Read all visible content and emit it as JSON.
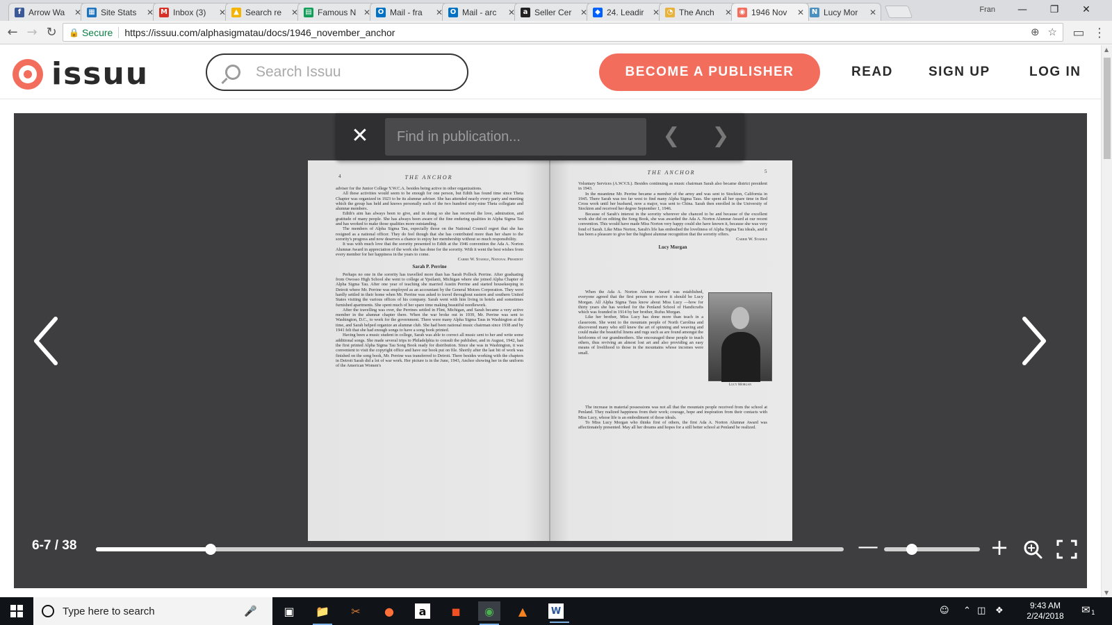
{
  "browser": {
    "tabs": [
      {
        "label": "Arrow Wa",
        "icon": "facebook-icon",
        "color": "#3b5998"
      },
      {
        "label": "Site Stats",
        "icon": "grid-icon",
        "color": "#1e73be"
      },
      {
        "label": "Inbox (3)",
        "icon": "gmail-icon",
        "color": "#d93025"
      },
      {
        "label": "Search re",
        "icon": "drive-icon",
        "color": "#f4b400"
      },
      {
        "label": "Famous N",
        "icon": "sheets-icon",
        "color": "#0f9d58"
      },
      {
        "label": "Mail - fra",
        "icon": "outlook-icon",
        "color": "#0072c6"
      },
      {
        "label": "Mail - arc",
        "icon": "outlook-icon",
        "color": "#0072c6"
      },
      {
        "label": "Seller Cer",
        "icon": "amazon-icon",
        "color": "#222222"
      },
      {
        "label": "24. Leadir",
        "icon": "dropbox-icon",
        "color": "#0061fe"
      },
      {
        "label": "The Anch",
        "icon": "clock-icon",
        "color": "#e8b33c"
      },
      {
        "label": "1946 Nov",
        "icon": "issuu-icon",
        "color": "#f36d5d",
        "active": true
      },
      {
        "label": "Lucy Mor",
        "icon": "nc-icon",
        "color": "#4a8fc1"
      }
    ],
    "user": "Fran",
    "address": {
      "secure_label": "Secure",
      "url": "https://issuu.com/alphasigmatau/docs/1946_november_anchor"
    }
  },
  "site": {
    "logo_text": "issuu",
    "search_placeholder": "Search Issuu",
    "publisher_button": "BECOME A PUBLISHER",
    "nav": {
      "read": "READ",
      "signup": "SIGN UP",
      "login": "LOG IN"
    },
    "colors": {
      "accent": "#f36d5d"
    }
  },
  "reader": {
    "find_placeholder": "Find in publication...",
    "page_count": "6-7 / 38",
    "progress": 0.153,
    "zoom_level": 0.29,
    "left_page": {
      "number": "4",
      "running_head": "THE ANCHOR",
      "para1": "adviser for the Junior College Y.W.C.A. besides being active in other organizations.",
      "para2": "All these activities would seem to be enough for one person, but Edith has found time since Theta Chapter was organized in 1923 to be its alumnæ adviser. She has attended nearly every party and meeting which the group has held and knows personally each of the two hundred sixty-nine Theta collegiate and alumnæ members.",
      "para3": "Edith's aim has always been to give, and in doing so she has received the love, admiration, and gratitude of many people. She has always been aware of the fine enduring qualities in Alpha Sigma Tau and has worked to make those qualities more outstanding.",
      "para4": "The members of Alpha Sigma Tau, especially those on the National Council regret that she has resigned as a national officer. They do feel though that she has contributed more than her share to the sorority's progress and now deserves a chance to enjoy her membership without so much responsibility.",
      "para5": "It was with much love that the sorority presented to Edith at the 1946 convention the Ada A. Norton Alumnæ Award in appreciation of the work she has done for the sorority. With it went the best wishes from every member for her happiness in the years to come.",
      "signature1": "Carrie W. Staehle, National President",
      "heading2": "Sarah P. Perrine",
      "para6": "Perhaps no one in the sorority has travelled more than has Sarah Pollock Perrine. After graduating from Owosso High School she went to college at Ypsilanti, Michigan where she joined Alpha Chapter of Alpha Sigma Tau. After one year of teaching she married Austin Perrine and started housekeeping in Detroit where Mr. Perrine was employed as an accountant by the General Motors Corporation. They were hardly settled in their home when Mr. Perrine was asked to travel throughout eastern and southern United States visiting the various offices of his company. Sarah went with him living in hotels and sometimes furnished apartments. She spent much of her spare time making beautiful needlework.",
      "para7": "After the travelling was over, the Perrines settled in Flint, Michigan, and Sarah became a very active member in the alumnæ chapter there. When the war broke out in 1939, Mr. Perrine was sent to Washington, D.C., to work for the government. There were many Alpha Sigma Taus in Washington at the time, and Sarah helped organize an alumnæ club. She had been national music chairman since 1938 and by 1941 felt that she had enough songs to have a song book printed.",
      "para8": "Having been a music student in college, Sarah was able to correct all music sent to her and write some additional songs. She made several trips to Philadelphia to consult the publisher, and in August, 1942, had the first printed Alpha Sigma Tau Song Book ready for distribution. Since she was in Washington, it was convenient to visit the copyright office and have our book put on file. Shortly after the last bit of work was finished on the song book, Mr. Perrine was transferred to Detroit. There besides working with the chapters in Detroit Sarah did a lot of war work. Her picture is in the June, 1943, Anchor showing her in the uniform of the American Women's"
    },
    "right_page": {
      "number": "5",
      "running_head": "THE ANCHOR",
      "para1": "Voluntary Services (A.W.V.S.). Besides continuing as music chairman Sarah also became district president in 1943.",
      "para2": "In the meantime Mr. Perrine became a member of the army and was sent to Stockton, California in 1945. There Sarah was too far west to find many Alpha Sigma Taus. She spent all her spare time in Red Cross work until her husband, now a major, was sent to China. Sarah then enrolled in the University of Stockton and received her degree September 1, 1946.",
      "para3": "Because of Sarah's interest in the sorority wherever she chanced to be and because of the excellent work she did on editing the Song Book, she was awarded the Ada A. Norton Alumnæ Award at our recent convention. This would have made Miss Norton very happy could she have known it, because she was very fond of Sarah. Like Miss Norton, Sarah's life has embodied the loveliness of Alpha Sigma Tau ideals, and it has been a pleasure to give her the highest alumnæ recognition that the sorority offers.",
      "signature1": "Carrie W. Staehle",
      "heading2": "Lucy Morgan",
      "para4": "When the Ada A. Norton Alumnæ Award was established, everyone agreed that the first person to receive it should be Lucy Morgan. All Alpha Sigma Taus know about Miss Lucy —how for thirty years she has worked for the Penland School of Handicrafts which was founded in 1914 by her brother, Rufus Morgan.",
      "para5": "Like her brother, Miss Lucy has done more than teach in a classroom. She went to the mountain people of North Carolina and discovered many who still knew the art of spinning and weaving and could make the beautiful linens and rugs such as are found amongst the heirlooms of our grandmothers. She encouraged these people to teach others, thus reviving an almost lost art and also providing an easy means of livelihood to those in the mountains whose incomes were small.",
      "para6": "The increase in material possessions was not all that the mountain people received from the school at Penland. They realized happiness from their work; courage, hope and inspiration from their contacts with Miss Lucy, whose life is an embodiment of those ideals.",
      "para7": "To Miss Lucy Morgan who thinks first of others, the first Ada A. Norton Alumnæ Award was affectionately presented. May all her dreams and hopes for a still better school at Penland be realized.",
      "caption": "Lucy Morgan"
    }
  },
  "taskbar": {
    "search_placeholder": "Type here to search",
    "time": "9:43 AM",
    "date": "2/24/2018",
    "notification_count": "1"
  }
}
